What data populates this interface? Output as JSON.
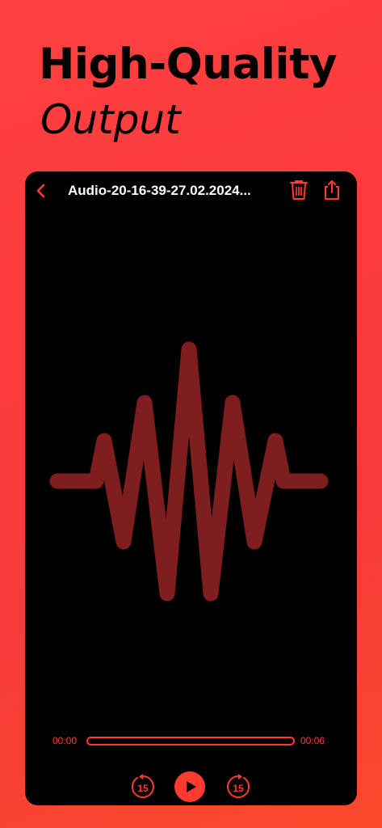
{
  "promo": {
    "headline": "High-Quality",
    "subhead": "Output"
  },
  "player": {
    "title": "Audio-20-16-39-27.02.2024...",
    "current_time": "00:00",
    "total_time": "00:06",
    "progress": 0,
    "skip_back_label": "15",
    "skip_forward_label": "15"
  },
  "icons": {
    "back": "chevron-left-icon",
    "trash": "trash-icon",
    "share": "share-icon",
    "play": "play-icon",
    "skip_back": "rewind-15-icon",
    "skip_forward": "forward-15-icon"
  },
  "colors": {
    "accent": "#ff3b30",
    "waveform": "#7e1e1e",
    "background": "#000000"
  }
}
